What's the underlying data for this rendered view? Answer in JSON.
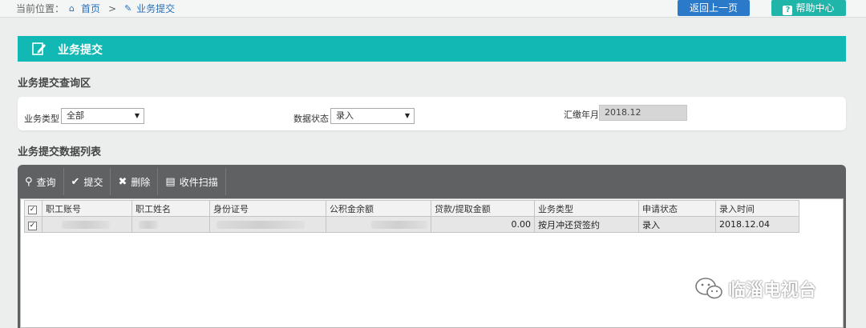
{
  "breadcrumb": {
    "prefix": "当前位置：",
    "home": "首页",
    "separator": ">",
    "current": "业务提交"
  },
  "top_buttons": {
    "back": "返回上一页",
    "help": "帮助中心"
  },
  "banner": {
    "title": "业务提交"
  },
  "query_section": {
    "title": "业务提交查询区",
    "fields": {
      "business_type_label": "业务类型",
      "business_type_value": "全部",
      "data_status_label": "数据状态",
      "data_status_value": "录入",
      "pay_month_label": "汇缴年月",
      "pay_month_value": "2018.12"
    }
  },
  "list_section": {
    "title": "业务提交数据列表",
    "toolbar": {
      "query": "查询",
      "submit": "提交",
      "delete": "删除",
      "scan": "收件扫描"
    },
    "columns": [
      "职工账号",
      "职工姓名",
      "身份证号",
      "公积金余额",
      "贷款/提取金额",
      "业务类型",
      "申请状态",
      "录入时间"
    ],
    "rows": [
      {
        "checked": "✓",
        "account": "",
        "name": "",
        "id_number": "",
        "balance": "",
        "amount": "0.00",
        "business_type": "按月冲还贷签约",
        "status": "录入",
        "entry_time": "2018.12.04"
      }
    ],
    "header_check": "✓"
  },
  "watermark": {
    "text": "临淄电视台"
  }
}
